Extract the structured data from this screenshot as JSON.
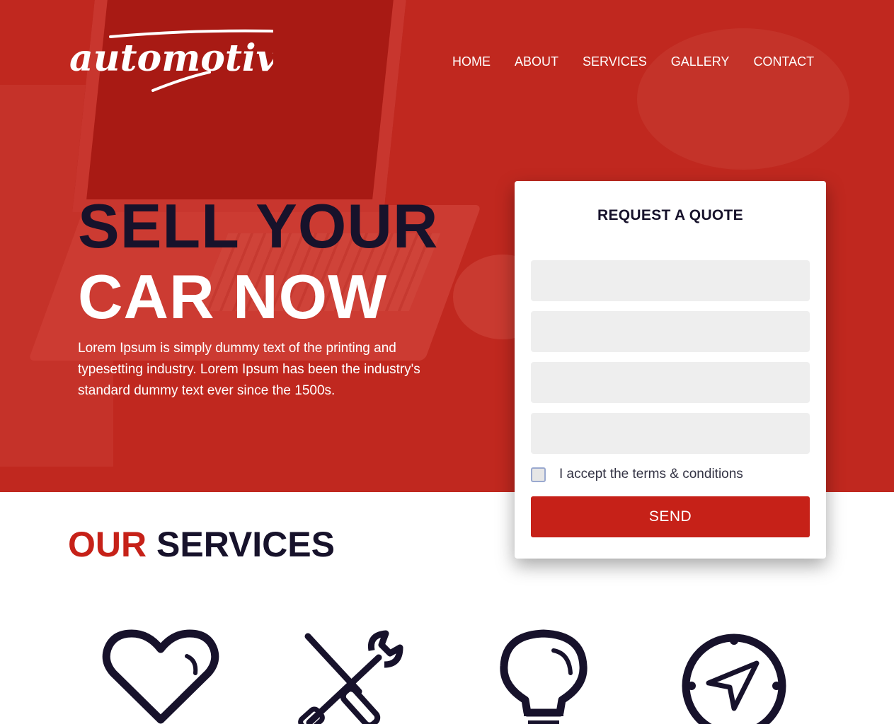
{
  "logo": {
    "text": "automotive"
  },
  "nav": {
    "items": [
      {
        "label": "HOME"
      },
      {
        "label": "ABOUT"
      },
      {
        "label": "SERVICES"
      },
      {
        "label": "GALLERY"
      },
      {
        "label": "CONTACT"
      }
    ]
  },
  "hero": {
    "headline_line1": "SELL YOUR",
    "headline_line2": "CAR NOW",
    "text": "Lorem Ipsum is simply dummy text of the printing and typesetting industry. Lorem Ipsum has been the industry's standard dummy text ever since the 1500s."
  },
  "quote_form": {
    "title": "REQUEST A QUOTE",
    "fields": [
      {
        "value": "",
        "placeholder": ""
      },
      {
        "value": "",
        "placeholder": ""
      },
      {
        "value": "",
        "placeholder": ""
      },
      {
        "value": "",
        "placeholder": ""
      }
    ],
    "terms_label": "I accept the terms & conditions",
    "terms_checked": false,
    "send_label": "SEND"
  },
  "services": {
    "title_highlight": "OUR",
    "title_rest": "SERVICES",
    "icons": [
      "heart-icon",
      "tools-icon",
      "lightbulb-icon",
      "compass-icon"
    ]
  },
  "colors": {
    "brand_red": "#c62118",
    "hero_red": "#c0281f",
    "dark_navy": "#17122b",
    "field_bg": "#eeeeee"
  }
}
